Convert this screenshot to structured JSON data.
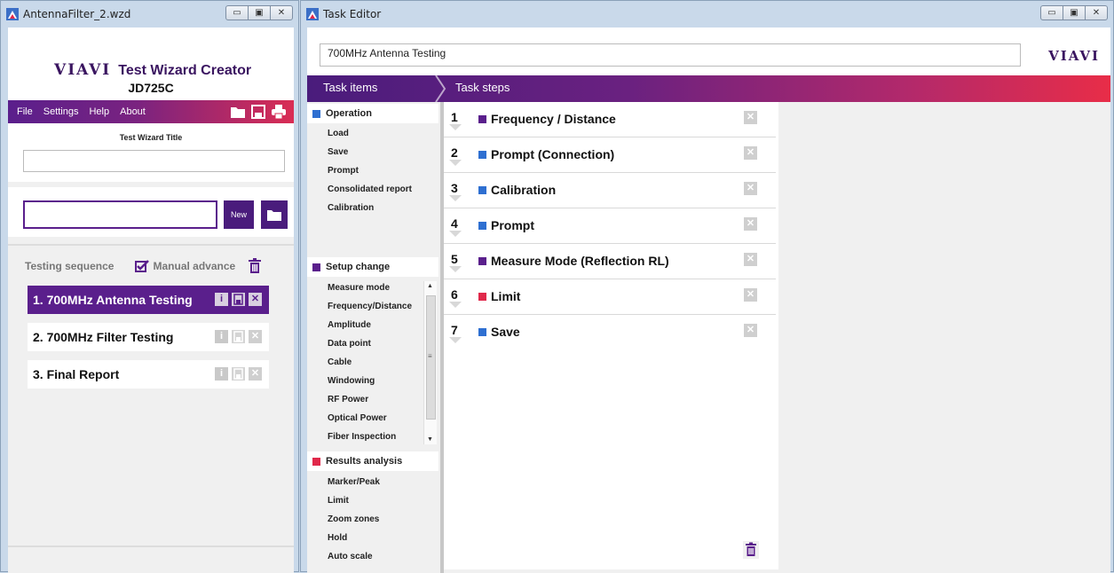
{
  "colors": {
    "brand_purple": "#5a1f8c",
    "operation_blue": "#2e6fd1",
    "setup_purple": "#5a1f8c",
    "results_red": "#e0284a"
  },
  "left_window": {
    "title": "AntennaFilter_2.wzd",
    "brand": "VIAVI",
    "product_name": "Test Wizard Creator",
    "model": "JD725C",
    "menu": [
      "File",
      "Settings",
      "Help",
      "About"
    ],
    "menu_icons": [
      "folder-open-icon",
      "save-icon",
      "print-icon"
    ],
    "test_wizard_title_label": "Test Wizard Title",
    "test_wizard_title_value": "",
    "new_input_value": "",
    "new_button": "New",
    "sequence_label": "Testing sequence",
    "manual_advance_label": "Manual advance",
    "manual_advance_checked": true,
    "sequence": [
      {
        "label": "1. 700MHz Antenna Testing",
        "active": true
      },
      {
        "label": "2. 700MHz Filter Testing",
        "active": false
      },
      {
        "label": "3. Final Report",
        "active": false
      }
    ]
  },
  "right_window": {
    "title": "Task Editor",
    "task_name": "700MHz Antenna Testing",
    "brand": "VIAVI",
    "tabs": {
      "items": "Task items",
      "steps": "Task steps"
    },
    "categories": {
      "operation": {
        "label": "Operation",
        "items": [
          "Load",
          "Save",
          "Prompt",
          "Consolidated report",
          "Calibration"
        ]
      },
      "setup": {
        "label": "Setup change",
        "items": [
          "Measure mode",
          "Frequency/Distance",
          "Amplitude",
          "Data point",
          "Cable",
          "Windowing",
          "RF Power",
          "Optical Power",
          "Fiber Inspection"
        ]
      },
      "results": {
        "label": "Results analysis",
        "items": [
          "Marker/Peak",
          "Limit",
          "Zoom zones",
          "Hold",
          "Auto scale"
        ]
      }
    },
    "steps": [
      {
        "num": "1",
        "label": "Frequency / Distance",
        "color": "#5a1f8c"
      },
      {
        "num": "2",
        "label": "Prompt (Connection)",
        "color": "#2e6fd1"
      },
      {
        "num": "3",
        "label": "Calibration",
        "color": "#2e6fd1"
      },
      {
        "num": "4",
        "label": "Prompt",
        "color": "#2e6fd1"
      },
      {
        "num": "5",
        "label": "Measure Mode (Reflection RL)",
        "color": "#5a1f8c"
      },
      {
        "num": "6",
        "label": "Limit",
        "color": "#e0284a"
      },
      {
        "num": "7",
        "label": "Save",
        "color": "#2e6fd1"
      }
    ]
  }
}
